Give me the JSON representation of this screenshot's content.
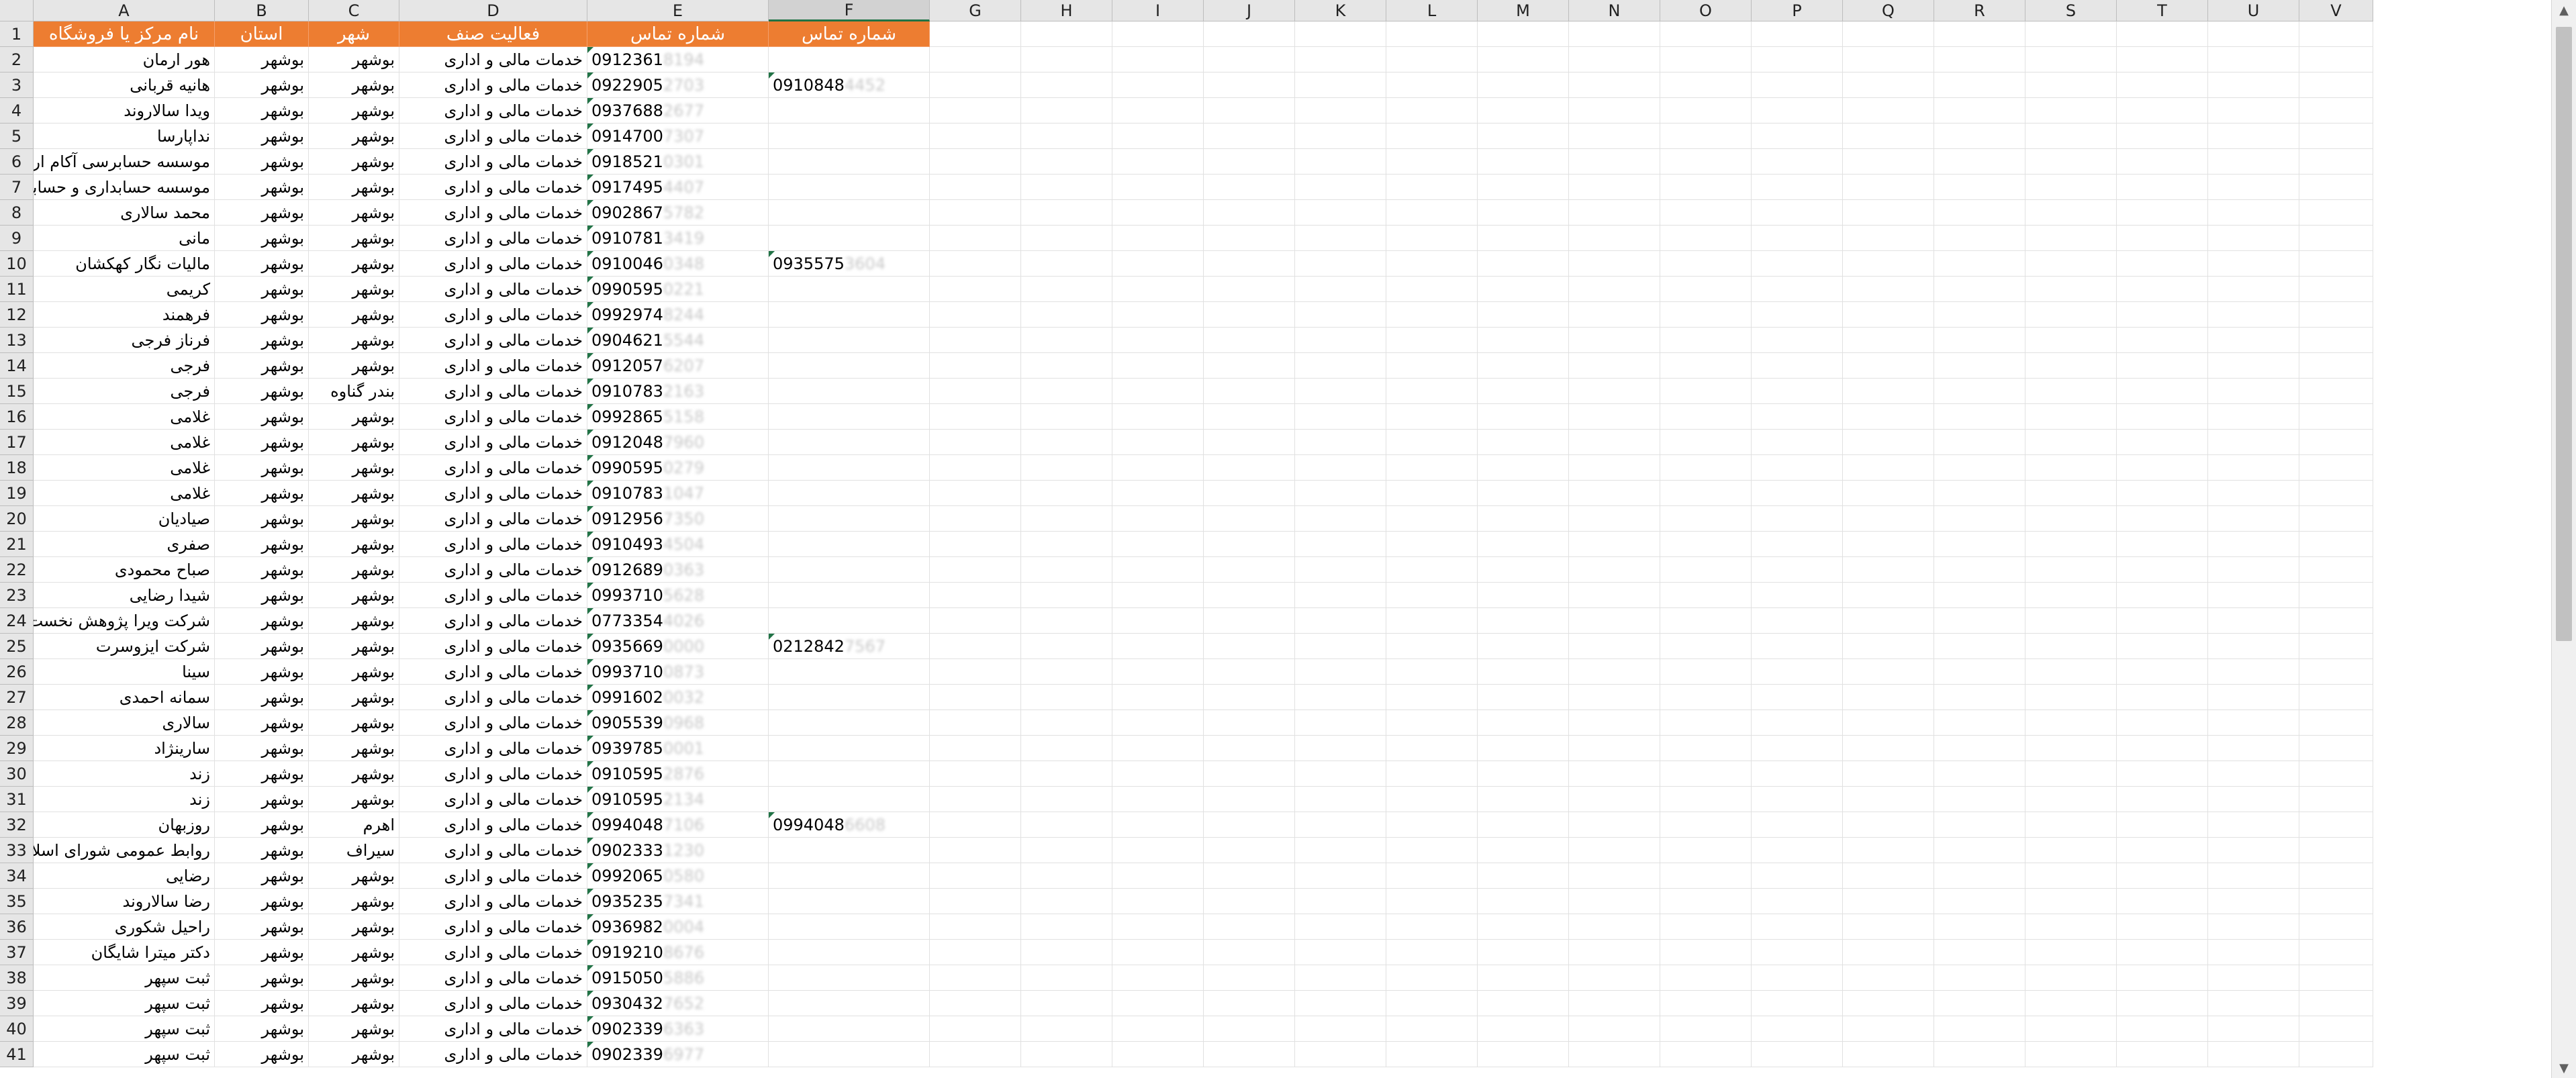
{
  "columns": [
    "A",
    "B",
    "C",
    "D",
    "E",
    "F",
    "G",
    "H",
    "I",
    "J",
    "K",
    "L",
    "M",
    "N",
    "O",
    "P",
    "Q",
    "R",
    "S",
    "T",
    "U",
    "V"
  ],
  "header": {
    "a": "نام مرکز یا فروشگاه",
    "b": "استان",
    "c": "شهر",
    "d": "فعالیت صنف",
    "e": "شماره تماس",
    "f": "شماره تماس"
  },
  "rows": [
    {
      "num": "2",
      "name": "هور ارمان",
      "province": "بوشهر",
      "city": "بوشهر",
      "activity": "خدمات مالی و اداری",
      "phone": "0912361",
      "phone_hidden": "8194",
      "phone2": "",
      "phone2_hidden": ""
    },
    {
      "num": "3",
      "name": "هانیه قربانی",
      "province": "بوشهر",
      "city": "بوشهر",
      "activity": "خدمات مالی و اداری",
      "phone": "0922905",
      "phone_hidden": "2703",
      "phone2": "0910848",
      "phone2_hidden": "4452"
    },
    {
      "num": "4",
      "name": "ویدا سالاروند",
      "province": "بوشهر",
      "city": "بوشهر",
      "activity": "خدمات مالی و اداری",
      "phone": "0937688",
      "phone_hidden": "2677",
      "phone2": "",
      "phone2_hidden": ""
    },
    {
      "num": "5",
      "name": "نداپارسا",
      "province": "بوشهر",
      "city": "بوشهر",
      "activity": "خدمات مالی و اداری",
      "phone": "0914700",
      "phone_hidden": "7307",
      "phone2": "",
      "phone2_hidden": ""
    },
    {
      "num": "6",
      "name": "موسسه حسابرسی آکام ارقام",
      "province": "بوشهر",
      "city": "بوشهر",
      "activity": "خدمات مالی و اداری",
      "phone": "0918521",
      "phone_hidden": "0301",
      "phone2": "",
      "phone2_hidden": ""
    },
    {
      "num": "7",
      "name": "موسسه حسابداری و حسابرسی محمودی",
      "province": "بوشهر",
      "city": "بوشهر",
      "activity": "خدمات مالی و اداری",
      "phone": "0917495",
      "phone_hidden": "4407",
      "phone2": "",
      "phone2_hidden": ""
    },
    {
      "num": "8",
      "name": "محمد سالاری",
      "province": "بوشهر",
      "city": "بوشهر",
      "activity": "خدمات مالی و اداری",
      "phone": "0902867",
      "phone_hidden": "5782",
      "phone2": "",
      "phone2_hidden": ""
    },
    {
      "num": "9",
      "name": "مانی",
      "province": "بوشهر",
      "city": "بوشهر",
      "activity": "خدمات مالی و اداری",
      "phone": "0910781",
      "phone_hidden": "3419",
      "phone2": "",
      "phone2_hidden": ""
    },
    {
      "num": "10",
      "name": "مالیات نگار کهکشان",
      "province": "بوشهر",
      "city": "بوشهر",
      "activity": "خدمات مالی و اداری",
      "phone": "0910046",
      "phone_hidden": "0348",
      "phone2": "0935575",
      "phone2_hidden": "3604"
    },
    {
      "num": "11",
      "name": "کریمی",
      "province": "بوشهر",
      "city": "بوشهر",
      "activity": "خدمات مالی و اداری",
      "phone": "0990595",
      "phone_hidden": "0221",
      "phone2": "",
      "phone2_hidden": ""
    },
    {
      "num": "12",
      "name": "فرهمند",
      "province": "بوشهر",
      "city": "بوشهر",
      "activity": "خدمات مالی و اداری",
      "phone": "0992974",
      "phone_hidden": "8244",
      "phone2": "",
      "phone2_hidden": ""
    },
    {
      "num": "13",
      "name": "فرناز فرجی",
      "province": "بوشهر",
      "city": "بوشهر",
      "activity": "خدمات مالی و اداری",
      "phone": "0904621",
      "phone_hidden": "5544",
      "phone2": "",
      "phone2_hidden": ""
    },
    {
      "num": "14",
      "name": "فرجی",
      "province": "بوشهر",
      "city": "بوشهر",
      "activity": "خدمات مالی و اداری",
      "phone": "0912057",
      "phone_hidden": "6207",
      "phone2": "",
      "phone2_hidden": ""
    },
    {
      "num": "15",
      "name": "فرجی",
      "province": "بوشهر",
      "city": "بندر گناوه",
      "activity": "خدمات مالی و اداری",
      "phone": "0910783",
      "phone_hidden": "2163",
      "phone2": "",
      "phone2_hidden": ""
    },
    {
      "num": "16",
      "name": "غلامی",
      "province": "بوشهر",
      "city": "بوشهر",
      "activity": "خدمات مالی و اداری",
      "phone": "0992865",
      "phone_hidden": "5158",
      "phone2": "",
      "phone2_hidden": ""
    },
    {
      "num": "17",
      "name": "غلامی",
      "province": "بوشهر",
      "city": "بوشهر",
      "activity": "خدمات مالی و اداری",
      "phone": "0912048",
      "phone_hidden": "7960",
      "phone2": "",
      "phone2_hidden": ""
    },
    {
      "num": "18",
      "name": "غلامی",
      "province": "بوشهر",
      "city": "بوشهر",
      "activity": "خدمات مالی و اداری",
      "phone": "0990595",
      "phone_hidden": "0279",
      "phone2": "",
      "phone2_hidden": ""
    },
    {
      "num": "19",
      "name": "غلامی",
      "province": "بوشهر",
      "city": "بوشهر",
      "activity": "خدمات مالی و اداری",
      "phone": "0910783",
      "phone_hidden": "1047",
      "phone2": "",
      "phone2_hidden": ""
    },
    {
      "num": "20",
      "name": "صیادیان",
      "province": "بوشهر",
      "city": "بوشهر",
      "activity": "خدمات مالی و اداری",
      "phone": "0912956",
      "phone_hidden": "7350",
      "phone2": "",
      "phone2_hidden": ""
    },
    {
      "num": "21",
      "name": "صفری",
      "province": "بوشهر",
      "city": "بوشهر",
      "activity": "خدمات مالی و اداری",
      "phone": "0910493",
      "phone_hidden": "4504",
      "phone2": "",
      "phone2_hidden": ""
    },
    {
      "num": "22",
      "name": "صباح محمودی",
      "province": "بوشهر",
      "city": "بوشهر",
      "activity": "خدمات مالی و اداری",
      "phone": "0912689",
      "phone_hidden": "0363",
      "phone2": "",
      "phone2_hidden": ""
    },
    {
      "num": "23",
      "name": "شیدا رضایی",
      "province": "بوشهر",
      "city": "بوشهر",
      "activity": "خدمات مالی و اداری",
      "phone": "0993710",
      "phone_hidden": "5628",
      "phone2": "",
      "phone2_hidden": ""
    },
    {
      "num": "24",
      "name": "شرکت ویرا پژوهش نخست (Ltd. Co.)",
      "province": "بوشهر",
      "city": "بوشهر",
      "activity": "خدمات مالی و اداری",
      "phone": "0773354",
      "phone_hidden": "4026",
      "phone2": "",
      "phone2_hidden": ""
    },
    {
      "num": "25",
      "name": "شرکت ایزوسرت",
      "province": "بوشهر",
      "city": "بوشهر",
      "activity": "خدمات مالی و اداری",
      "phone": "0935669",
      "phone_hidden": "0000",
      "phone2": "0212842",
      "phone2_hidden": "7567"
    },
    {
      "num": "26",
      "name": "سینا",
      "province": "بوشهر",
      "city": "بوشهر",
      "activity": "خدمات مالی و اداری",
      "phone": "0993710",
      "phone_hidden": "0873",
      "phone2": "",
      "phone2_hidden": ""
    },
    {
      "num": "27",
      "name": "سمانه احمدی",
      "province": "بوشهر",
      "city": "بوشهر",
      "activity": "خدمات مالی و اداری",
      "phone": "0991602",
      "phone_hidden": "0032",
      "phone2": "",
      "phone2_hidden": ""
    },
    {
      "num": "28",
      "name": "سالاری",
      "province": "بوشهر",
      "city": "بوشهر",
      "activity": "خدمات مالی و اداری",
      "phone": "0905539",
      "phone_hidden": "0968",
      "phone2": "",
      "phone2_hidden": ""
    },
    {
      "num": "29",
      "name": "سارینژاد",
      "province": "بوشهر",
      "city": "بوشهر",
      "activity": "خدمات مالی و اداری",
      "phone": "0939785",
      "phone_hidden": "0001",
      "phone2": "",
      "phone2_hidden": ""
    },
    {
      "num": "30",
      "name": "زند",
      "province": "بوشهر",
      "city": "بوشهر",
      "activity": "خدمات مالی و اداری",
      "phone": "0910595",
      "phone_hidden": "2876",
      "phone2": "",
      "phone2_hidden": ""
    },
    {
      "num": "31",
      "name": "زند",
      "province": "بوشهر",
      "city": "بوشهر",
      "activity": "خدمات مالی و اداری",
      "phone": "0910595",
      "phone_hidden": "2134",
      "phone2": "",
      "phone2_hidden": ""
    },
    {
      "num": "32",
      "name": "روزبهان",
      "province": "بوشهر",
      "city": "اهرم",
      "activity": "خدمات مالی و اداری",
      "phone": "0994048",
      "phone_hidden": "7106",
      "phone2": "0994048",
      "phone2_hidden": "6608"
    },
    {
      "num": "33",
      "name": "روابط عمومی شورای اسلامی  و دهیاری بندر شیرینو",
      "province": "بوشهر",
      "city": "سیراف",
      "activity": "خدمات مالی و اداری",
      "phone": "0902333",
      "phone_hidden": "1230",
      "phone2": "",
      "phone2_hidden": ""
    },
    {
      "num": "34",
      "name": "رضایی",
      "province": "بوشهر",
      "city": "بوشهر",
      "activity": "خدمات مالی و اداری",
      "phone": "0992065",
      "phone_hidden": "0580",
      "phone2": "",
      "phone2_hidden": ""
    },
    {
      "num": "35",
      "name": "رضا سالاروند",
      "province": "بوشهر",
      "city": "بوشهر",
      "activity": "خدمات مالی و اداری",
      "phone": "0935235",
      "phone_hidden": "7341",
      "phone2": "",
      "phone2_hidden": ""
    },
    {
      "num": "36",
      "name": "راحیل شکوری",
      "province": "بوشهر",
      "city": "بوشهر",
      "activity": "خدمات مالی و اداری",
      "phone": "0936982",
      "phone_hidden": "0004",
      "phone2": "",
      "phone2_hidden": ""
    },
    {
      "num": "37",
      "name": "دکتر میترا شایگان",
      "province": "بوشهر",
      "city": "بوشهر",
      "activity": "خدمات مالی و اداری",
      "phone": "0919210",
      "phone_hidden": "8676",
      "phone2": "",
      "phone2_hidden": ""
    },
    {
      "num": "38",
      "name": "ثبت سپهر",
      "province": "بوشهر",
      "city": "بوشهر",
      "activity": "خدمات مالی و اداری",
      "phone": "0915050",
      "phone_hidden": "5886",
      "phone2": "",
      "phone2_hidden": ""
    },
    {
      "num": "39",
      "name": "ثبت سپهر",
      "province": "بوشهر",
      "city": "بوشهر",
      "activity": "خدمات مالی و اداری",
      "phone": "0930432",
      "phone_hidden": "7652",
      "phone2": "",
      "phone2_hidden": ""
    },
    {
      "num": "40",
      "name": "ثبت سپهر",
      "province": "بوشهر",
      "city": "بوشهر",
      "activity": "خدمات مالی و اداری",
      "phone": "0902339",
      "phone_hidden": "6363",
      "phone2": "",
      "phone2_hidden": ""
    },
    {
      "num": "41",
      "name": "ثبت سپهر",
      "province": "بوشهر",
      "city": "بوشهر",
      "activity": "خدمات مالی و اداری",
      "phone": "0902339",
      "phone_hidden": "6977",
      "phone2": "",
      "phone2_hidden": ""
    }
  ],
  "colors": {
    "header_fill": "#ed7d31",
    "header_text": "#ffffff",
    "grid_line": "#e1e1e1",
    "error_indicator": "#217346"
  },
  "icons": {
    "number_as_text_indicator": "green-triangle-icon",
    "scroll_up": "chevron-up-icon",
    "scroll_down": "chevron-down-icon"
  }
}
